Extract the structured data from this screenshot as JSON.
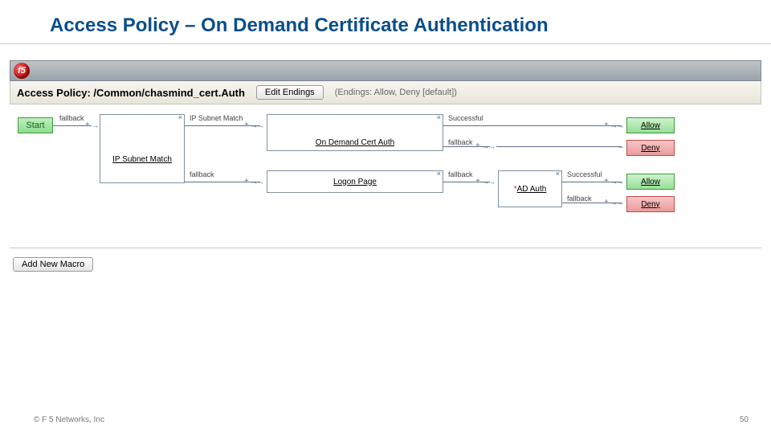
{
  "slide": {
    "title": "Access Policy – On Demand Certificate Authentication",
    "footer": "© F 5 Networks, Inc",
    "page_number": "50"
  },
  "app": {
    "logo_text": "f5",
    "policy_label": "Access Policy: ",
    "policy_path": "/Common/chasmind_cert.Auth",
    "edit_endings": "Edit Endings",
    "endings_hint": "(Endings: Allow, Deny [default])",
    "add_macro": "Add New Macro"
  },
  "nodes": {
    "start": "Start",
    "ip_subnet": "IP Subnet Match",
    "cert_auth": "On Demand Cert Auth",
    "logon": "Logon Page",
    "ad_auth": "AD Auth",
    "ad_star": "*",
    "allow": "Allow",
    "deny": "Deny"
  },
  "labels": {
    "fallback": "fallback",
    "ip_subnet_match": "IP Subnet Match",
    "successful": "Successful"
  }
}
